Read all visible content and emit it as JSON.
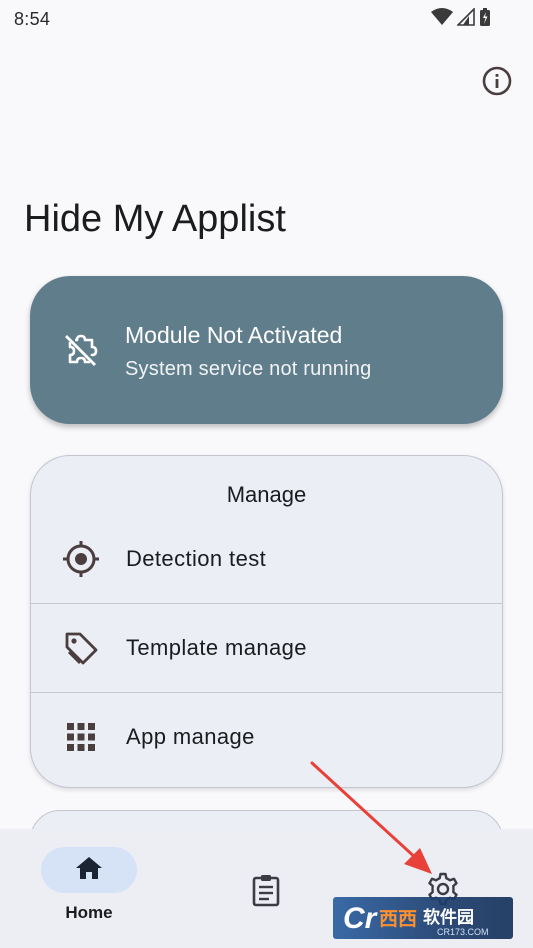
{
  "status_bar": {
    "time": "8:54"
  },
  "app": {
    "title": "Hide My Applist"
  },
  "module_status": {
    "title": "Module Not Activated",
    "subtitle": "System service not running",
    "color": "#607d8b"
  },
  "manage": {
    "header": "Manage",
    "items": [
      {
        "label": "Detection test",
        "icon": "target-icon"
      },
      {
        "label": "Template manage",
        "icon": "tag-icon"
      },
      {
        "label": "App manage",
        "icon": "grid-icon"
      }
    ]
  },
  "bottom_nav": {
    "items": [
      {
        "label": "Home",
        "icon": "home-icon",
        "selected": true
      },
      {
        "label": "",
        "icon": "clipboard-icon",
        "selected": false
      },
      {
        "label": "",
        "icon": "gear-icon",
        "selected": false
      }
    ]
  },
  "watermark": {
    "text_main": "西西软件园",
    "text_sub": "CR173.COM"
  }
}
